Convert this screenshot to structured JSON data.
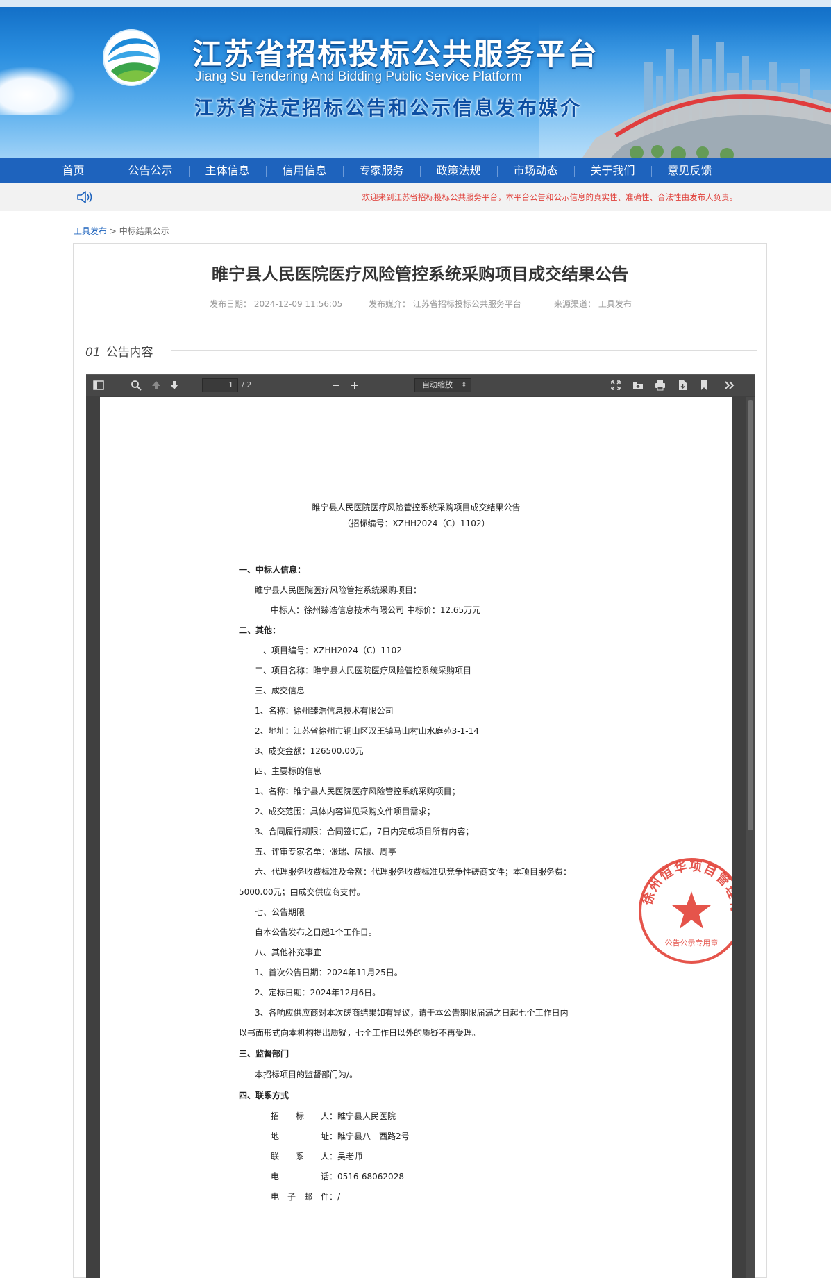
{
  "header": {
    "title_cn": "江苏省招标投标公共服务平台",
    "title_en": "Jiang Su Tendering And Bidding Public Service Platform",
    "subtitle": "江苏省法定招标公告和公示信息发布媒介"
  },
  "nav": {
    "items": [
      "首页",
      "公告公示",
      "主体信息",
      "信用信息",
      "专家服务",
      "政策法规",
      "市场动态",
      "关于我们",
      "意见反馈"
    ]
  },
  "notice": {
    "icon": "speaker-icon",
    "text": "欢迎来到江苏省招标投标公共服务平台，本平台公告和公示信息的真实性、准确性、合法性由发布人负责。"
  },
  "breadcrumb": {
    "link": "工具发布",
    "separator": ">",
    "current": "中标结果公示"
  },
  "article": {
    "title": "睢宁县人民医院医疗风险管控系统采购项目成交结果公告",
    "publish_date_label": "发布日期：",
    "publish_date": "2024-12-09 11:56:05",
    "media_label": "发布媒介：",
    "media": "江苏省招标投标公共服务平台",
    "source_label": "来源渠道：",
    "source": "工具发布",
    "section_num": "01",
    "section_title": "公告内容"
  },
  "viewer": {
    "page_current": "1",
    "page_total": "/ 2",
    "zoom": "自动缩放",
    "toolbar_icons": [
      "sidebar-toggle-icon",
      "search-icon",
      "previous-page-icon",
      "next-page-icon",
      "zoom-out-icon",
      "zoom-in-icon",
      "presentation-mode-icon",
      "open-file-icon",
      "print-icon",
      "download-icon",
      "bookmark-icon",
      "more-tools-icon"
    ]
  },
  "pdf": {
    "title": "睢宁县人民医院医疗风险管控系统采购项目成交结果公告",
    "code": "（招标编号：XZHH2024（C）1102）",
    "lines": [
      "一、中标人信息：",
      "睢宁县人民医院医疗风险管控系统采购项目：",
      "中标人：徐州臻浩信息技术有限公司 中标价：12.65万元",
      "二、其他：",
      "一、项目编号：XZHH2024（C）1102",
      "二、项目名称：睢宁县人民医院医疗风险管控系统采购项目",
      "三、成交信息",
      "1、名称：徐州臻浩信息技术有限公司",
      "2、地址：江苏省徐州市铜山区汉王镇马山村山水庭苑3-1-14",
      "3、成交金额：126500.00元",
      "四、主要标的信息",
      "1、名称：睢宁县人民医院医疗风险管控系统采购项目；",
      "2、成交范围：具体内容详见采购文件项目需求；",
      "3、合同履行期限：合同签订后，7日内完成项目所有内容；",
      "五、评审专家名单：张瑞、房振、周亭",
      "六、代理服务收费标准及金额：代理服务收费标准见竞争性磋商文件；本项目服务费：",
      "5000.00元；由成交供应商支付。",
      "七、公告期限",
      "自本公告发布之日起1个工作日。",
      "八、其他补充事宜",
      "1、首次公告日期：2024年11月25日。",
      "2、定标日期：2024年12月6日。",
      "3、各响应供应商对本次磋商结果如有异议，请于本公告期限届满之日起七个工作日内",
      "以书面形式向本机构提出质疑，七个工作日以外的质疑不再受理。",
      "三、监督部门",
      "本招标项目的监督部门为/。",
      "四、联系方式"
    ],
    "contacts": [
      {
        "label": "招　　标　　人：",
        "value": "睢宁县人民医院"
      },
      {
        "label": "地　　　　　址：",
        "value": "睢宁县八一西路2号"
      },
      {
        "label": "联　　系　　人：",
        "value": "吴老师"
      },
      {
        "label": "电　　　　　话：",
        "value": "0516-68062028"
      },
      {
        "label": "电　子　邮　件：",
        "value": "/"
      }
    ],
    "seal_text": "徐州恒华项目管理有限公司",
    "seal_subtext": "公告公示专用章"
  }
}
